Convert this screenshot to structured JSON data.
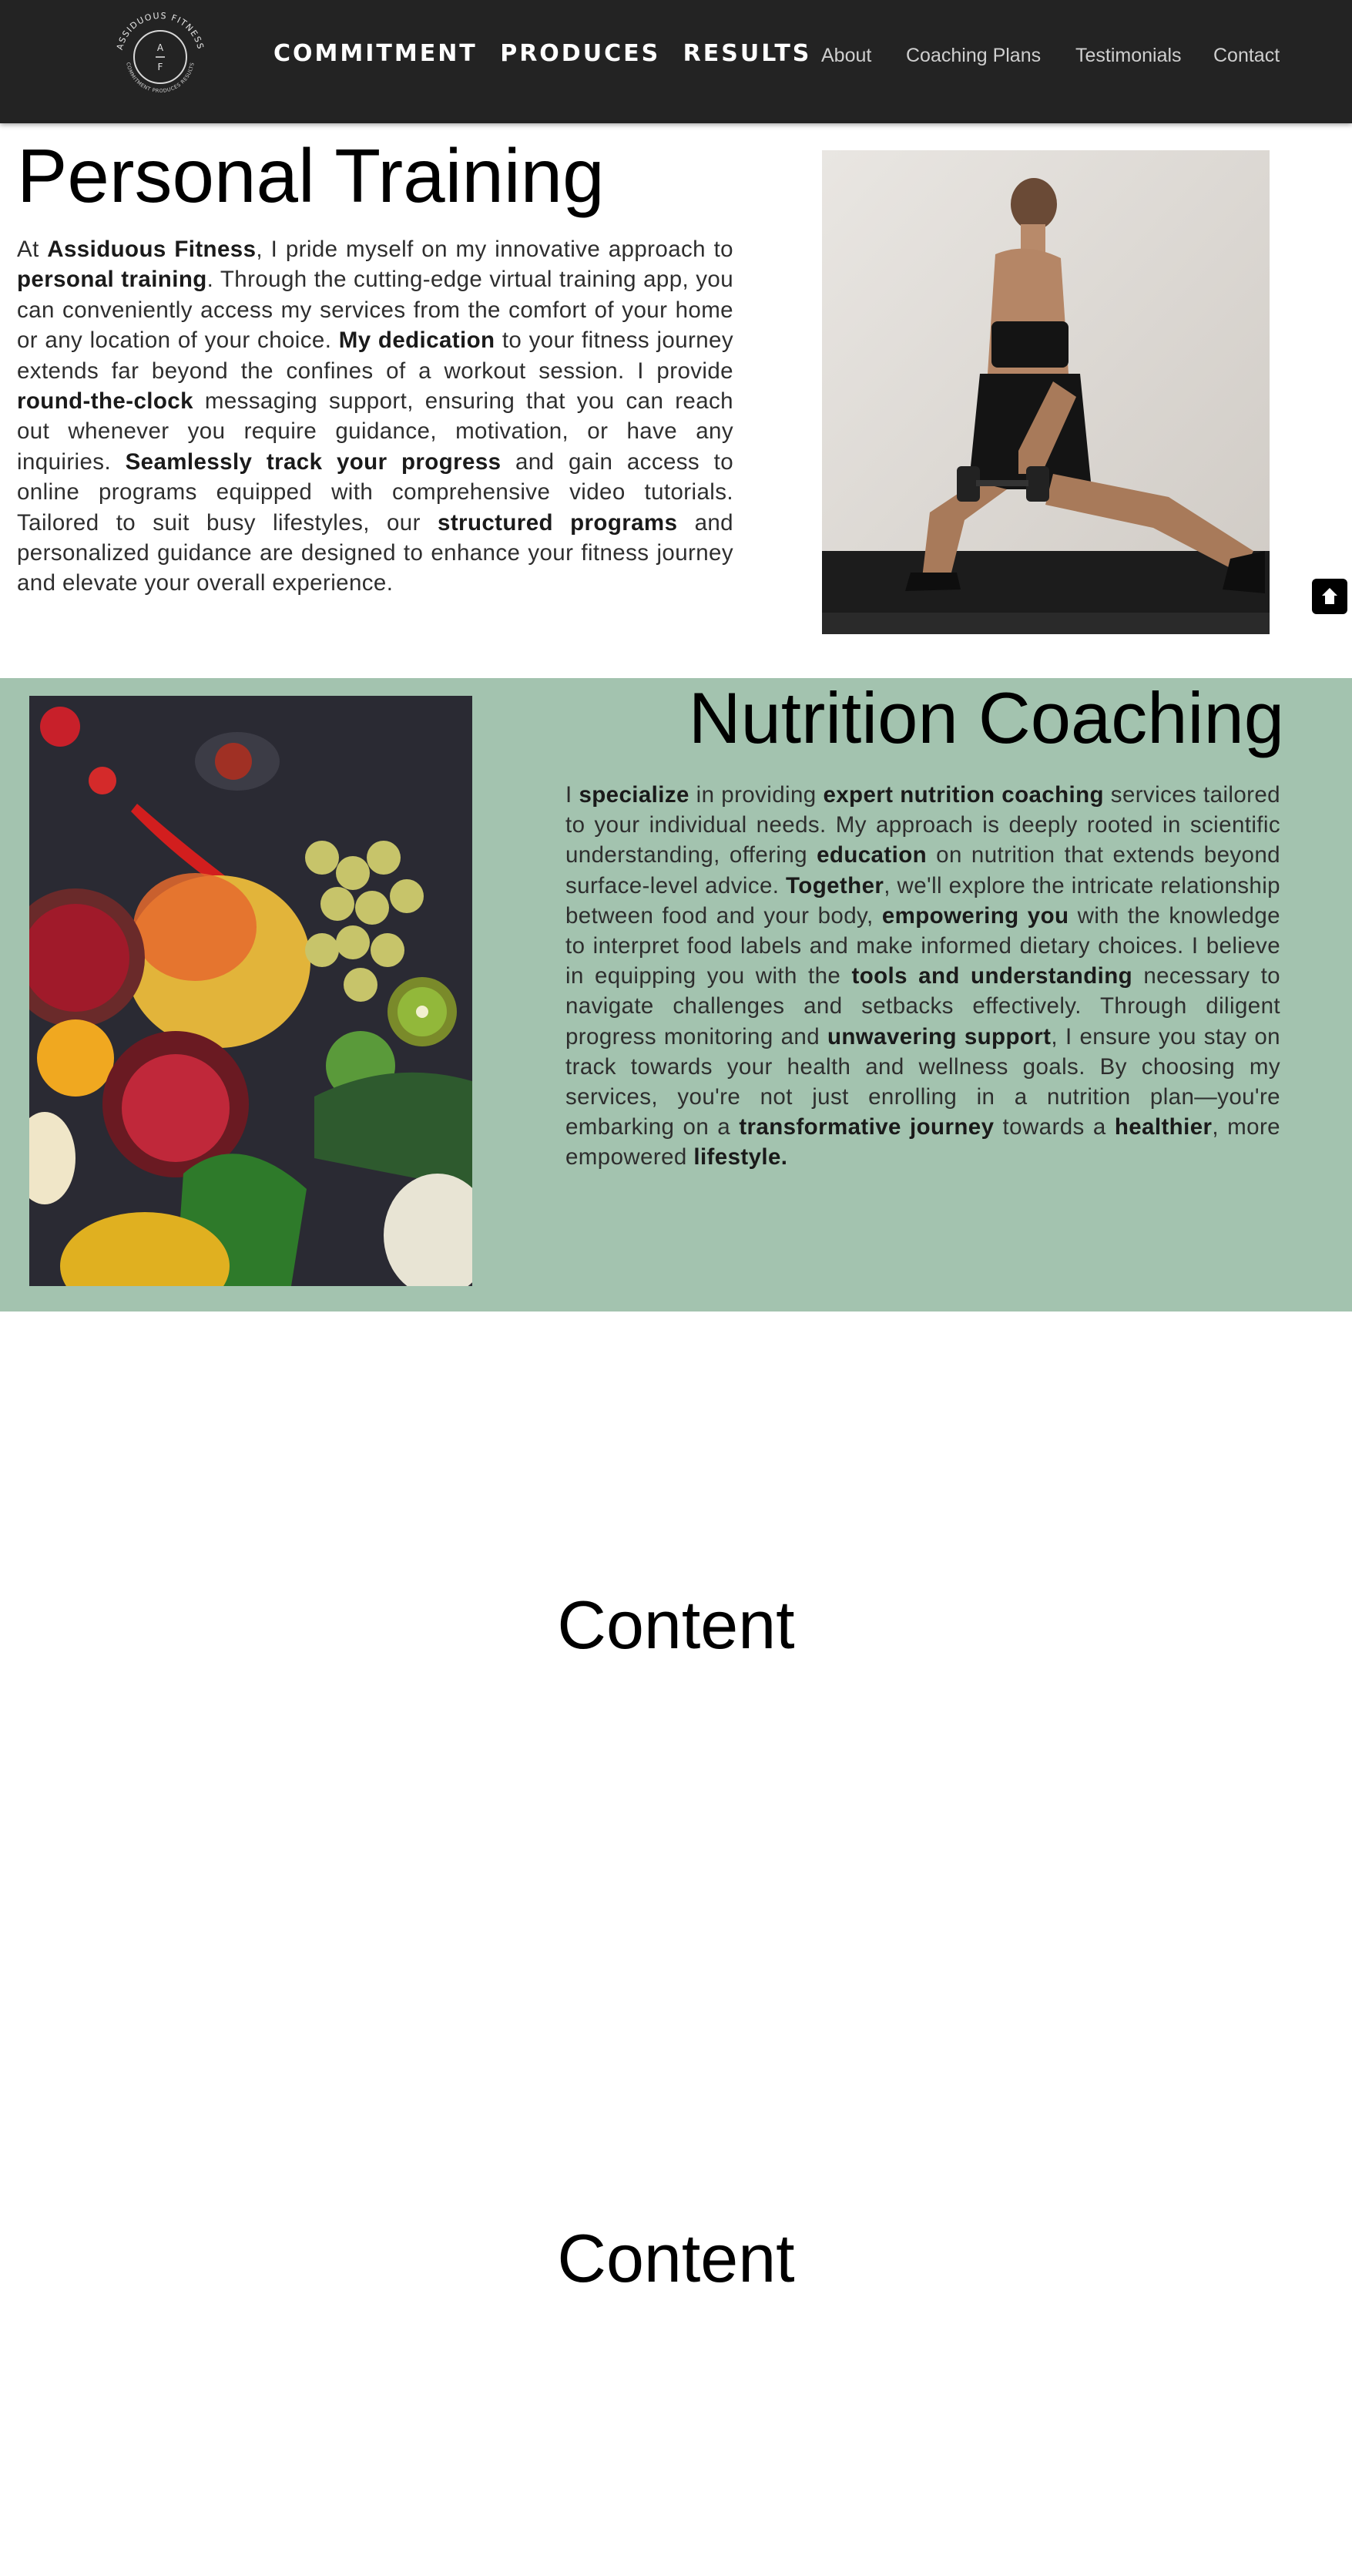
{
  "header": {
    "logo": {
      "ring_text_top": "ASSIDUOUS FITNESS",
      "ring_text_bottom": "COMMITMENT PRODUCES RESULTS",
      "monogram_top": "A",
      "monogram_bottom": "F"
    },
    "slogan": "COMMITMENT PRODUCES RESULTS",
    "nav": [
      {
        "label": "About"
      },
      {
        "label": "Coaching Plans"
      },
      {
        "label": "Testimonials"
      },
      {
        "label": "Contact"
      }
    ]
  },
  "personal_training": {
    "title": "Personal Training",
    "paragraph": [
      {
        "t": "At "
      },
      {
        "t": "Assiduous Fitness",
        "b": true
      },
      {
        "t": ", I pride myself on my innovative approach to "
      },
      {
        "t": "personal training",
        "b": true
      },
      {
        "t": ". Through the cutting-edge virtual training app, you can conveniently access my services from the comfort of your home or any location of your choice. "
      },
      {
        "t": "My dedication",
        "b": true
      },
      {
        "t": " to your fitness journey extends far beyond the confines of a workout session. I provide "
      },
      {
        "t": "round-the-clock",
        "b": true
      },
      {
        "t": " messaging support, ensuring that you can reach out whenever you require guidance, motivation, or have any inquiries. "
      },
      {
        "t": "Seamlessly track your progress",
        "b": true
      },
      {
        "t": " and gain access to online programs equipped with comprehensive video tutorials. Tailored to suit busy lifestyles, our "
      },
      {
        "t": "structured programs",
        "b": true
      },
      {
        "t": " and personalized guidance are designed to enhance your fitness journey and elevate your overall experience."
      }
    ]
  },
  "nutrition_coaching": {
    "title": "Nutrition Coaching",
    "paragraph": [
      {
        "t": "I "
      },
      {
        "t": "specialize",
        "b": true
      },
      {
        "t": " in providing "
      },
      {
        "t": "expert nutrition coaching",
        "b": true
      },
      {
        "t": " services tailored to your individual needs. My approach is deeply rooted in scientific understanding, offering "
      },
      {
        "t": "education",
        "b": true
      },
      {
        "t": " on nutrition that extends beyond surface-level advice. "
      },
      {
        "t": "Together",
        "b": true
      },
      {
        "t": ", we'll explore the intricate relationship between food and your body, "
      },
      {
        "t": "empowering you",
        "b": true
      },
      {
        "t": " with the knowledge to interpret food labels and make informed dietary choices. I believe in equipping you with the "
      },
      {
        "t": "tools and understanding",
        "b": true
      },
      {
        "t": " necessary to navigate challenges and setbacks effectively. Through diligent progress monitoring and "
      },
      {
        "t": "unwavering support",
        "b": true
      },
      {
        "t": ", I ensure you stay on track towards your health and wellness goals. By choosing my services, you're not just enrolling in a nutrition plan—you're embarking on a "
      },
      {
        "t": "transformative journey",
        "b": true
      },
      {
        "t": " towards a "
      },
      {
        "t": "healthier",
        "b": true
      },
      {
        "t": ", more empowered "
      },
      {
        "t": "lifestyle.",
        "b": true
      }
    ]
  },
  "content_sections": [
    {
      "title": "Content"
    },
    {
      "title": "Content"
    }
  ],
  "scroll_top": {
    "icon": "arrow-up-icon"
  },
  "colors": {
    "header_bg": "#232323",
    "nutrition_bg": "#a3c3af",
    "nav_text": "#cfcfcf"
  }
}
